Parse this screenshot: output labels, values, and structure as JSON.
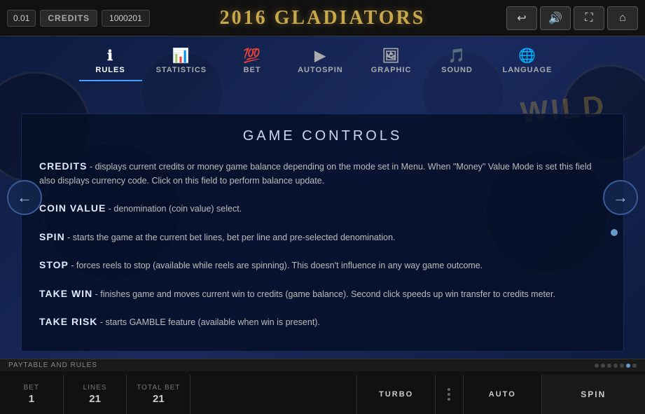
{
  "topbar": {
    "credit_value": "0.01",
    "credits_label": "CREDITS",
    "credits_amount": "1000201",
    "game_title": "2016 GLADIATORS",
    "btns": {
      "back": "↩",
      "sound": "🔊",
      "fullscreen": "⛶",
      "home": "⌂"
    }
  },
  "nav": {
    "tabs": [
      {
        "id": "rules",
        "label": "RULES",
        "icon": "ℹ",
        "active": true
      },
      {
        "id": "statistics",
        "label": "STATISTICS",
        "icon": "📊",
        "active": false
      },
      {
        "id": "bet",
        "label": "BET",
        "icon": "💯",
        "active": false
      },
      {
        "id": "autospin",
        "label": "AUTOSPIN",
        "icon": "▶",
        "active": false
      },
      {
        "id": "graphic",
        "label": "GRAPHIC",
        "icon": "🖼",
        "active": false
      },
      {
        "id": "sound",
        "label": "SOUND",
        "icon": "🎵",
        "active": false
      },
      {
        "id": "language",
        "label": "LANGUAGE",
        "icon": "🌐",
        "active": false
      }
    ]
  },
  "content": {
    "title": "GAME CONTROLS",
    "rules": [
      {
        "term": "CREDITS",
        "desc": "- displays current credits or money game balance depending on the mode set in Menu. When \"Money\" Value Mode is set this field also displays currency code. Click on this field to perform balance update."
      },
      {
        "term": "COIN VALUE",
        "desc": "- denomination (coin value) select."
      },
      {
        "term": "SPIN",
        "desc": "- starts the game at the current bet lines, bet per line and pre-selected denomination."
      },
      {
        "term": "STOP",
        "desc": "- forces reels to stop (available while reels are spinning). This doesn't influence in any way game outcome."
      },
      {
        "term": "TAKE WIN",
        "desc": "- finishes game and moves current win to credits (game balance). Second click speeds up win transfer to credits meter."
      },
      {
        "term": "TAKE RISK",
        "desc": "- starts GAMBLE feature (available when win is present)."
      }
    ]
  },
  "bottombar": {
    "paytable_label": "PAYTABLE AND RULES",
    "dots": [
      false,
      false,
      false,
      false,
      false,
      true,
      false
    ],
    "bet_label": "BET",
    "bet_value": "1",
    "lines_label": "LINES",
    "lines_value": "21",
    "total_bet_label": "TOTAL BET",
    "total_bet_value": "21",
    "turbo_label": "TURBO",
    "auto_label": "AUTO",
    "spin_label": "SPIN"
  }
}
